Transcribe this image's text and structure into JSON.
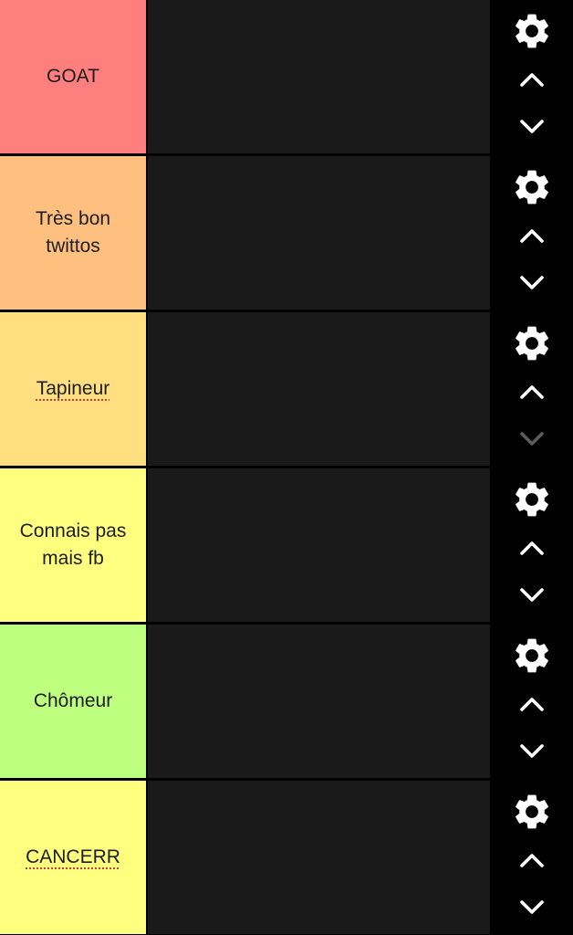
{
  "colors": {
    "page_bg": "#000000",
    "drop_area": "#1a1a1a",
    "icon": "#ffffff",
    "icon_disabled": "#5c5c5c"
  },
  "tiers": [
    {
      "label": "GOAT",
      "color": "#ff7f7f",
      "move_down_enabled": true
    },
    {
      "label": "Très bon\ntwittos",
      "color": "#ffbf7f",
      "move_down_enabled": true
    },
    {
      "label": "Tapineur",
      "color": "#ffdf7f",
      "move_down_enabled": false
    },
    {
      "label": "Connais pas\nmais fb",
      "color": "#ffff7f",
      "move_down_enabled": true
    },
    {
      "label": "Chômeur",
      "color": "#bfff7f",
      "move_down_enabled": true
    },
    {
      "label": "CANCERR",
      "color": "#ffff7f",
      "move_down_enabled": true
    }
  ],
  "icons": {
    "settings": "gear-icon",
    "move_up": "chevron-up-icon",
    "move_down": "chevron-down-icon"
  }
}
